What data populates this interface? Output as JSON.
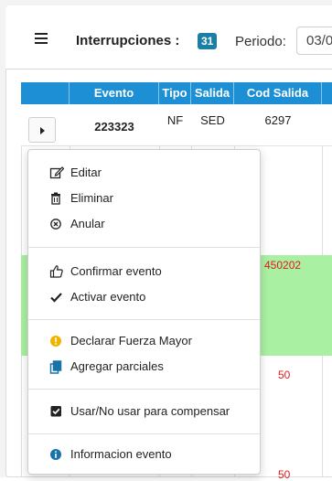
{
  "toolbar": {
    "title": "Interrupciones :",
    "count": "31",
    "periodo_label": "Periodo:",
    "periodo_value": "03/0"
  },
  "table": {
    "headers": [
      "Evento",
      "Tipo",
      "Salida",
      "Cod Salida"
    ],
    "row1": {
      "evento": "223323",
      "tipo": "NF",
      "salida": "SED",
      "cod_salida": "6297"
    },
    "partial_values": {
      "green_cod": "450202",
      "row3_cod": "50",
      "row4_cod": "50"
    }
  },
  "menu": {
    "editar": "Editar",
    "eliminar": "Eliminar",
    "anular": "Anular",
    "confirmar": "Confirmar evento",
    "activar": "Activar evento",
    "fuerza_mayor": "Declarar Fuerza Mayor",
    "parciales": "Agregar parciales",
    "compensar": "Usar/No usar para compensar",
    "informacion": "Informacion evento"
  },
  "colors": {
    "header_blue": "#1d8fd4",
    "badge": "#1a7fa7",
    "green_row": "#a9f0a2",
    "red_text": "#e21b1b",
    "warning": "#f0b400",
    "info": "#1a73a8"
  },
  "icons": [
    "menu-icon",
    "edit-icon",
    "trash-icon",
    "close-circle-icon",
    "thumbs-up-icon",
    "check-icon",
    "warning-circle-icon",
    "copy-icon",
    "checkbox-icon",
    "info-circle-icon",
    "caret-right-icon"
  ]
}
